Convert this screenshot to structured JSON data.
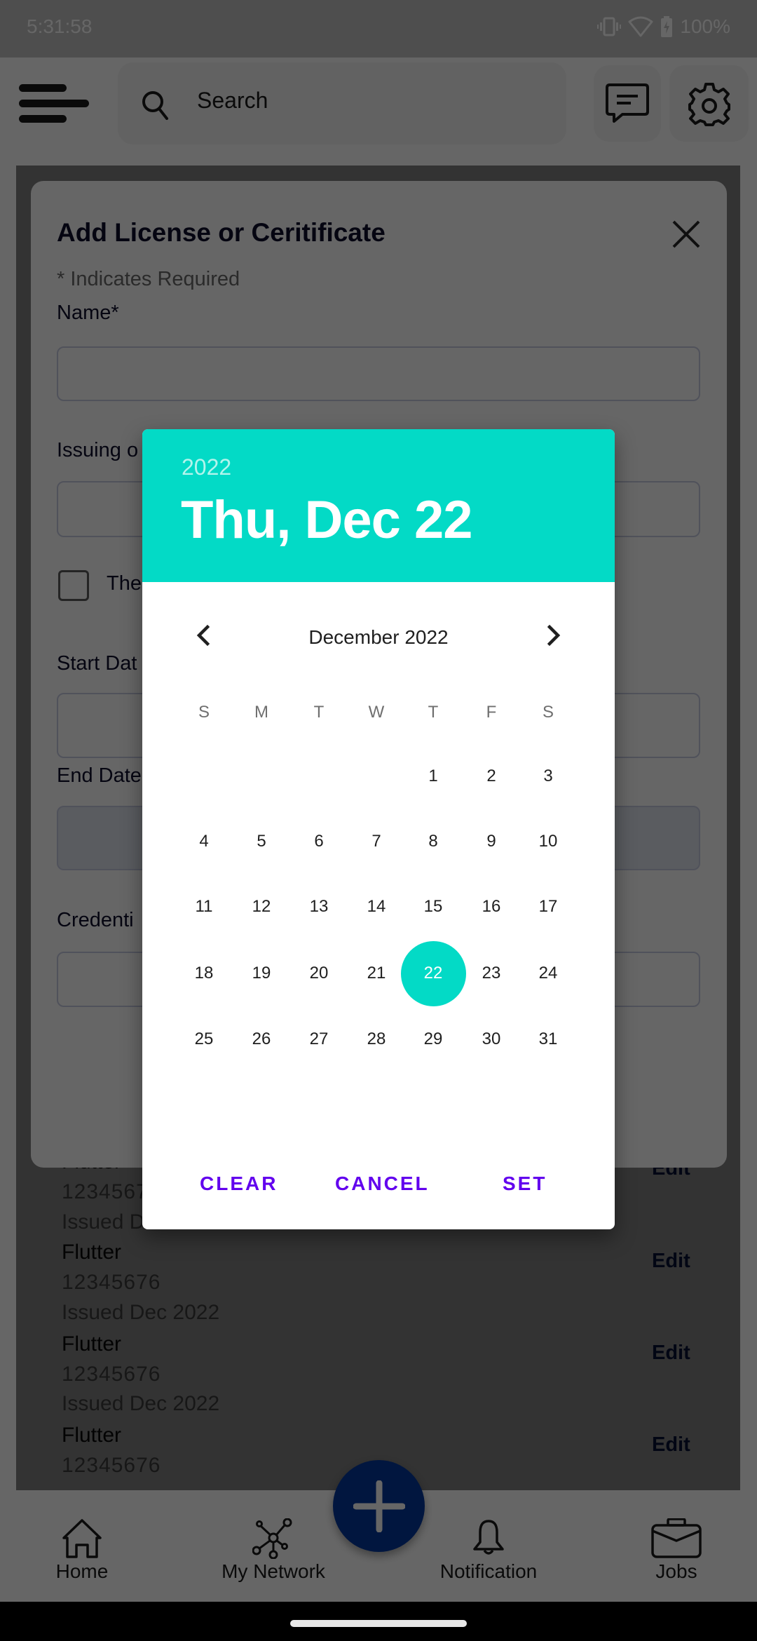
{
  "status_bar": {
    "time": "5:31:58",
    "battery": "100%",
    "icons": [
      "vibrate-icon",
      "wifi-icon",
      "battery-charging-icon"
    ]
  },
  "app_bar": {
    "menu_icon": "hamburger-menu-icon",
    "search_placeholder": "Search",
    "message_icon": "chat-message-icon",
    "settings_icon": "gear-icon"
  },
  "license_modal": {
    "title": "Add License or Ceritificate",
    "required_note": "* Indicates Required",
    "fields": {
      "name_label": "Name*",
      "name_value": "",
      "issuing_label": "Issuing o",
      "issuing_value": "",
      "checkbox_label": "The",
      "checkbox_checked": false,
      "start_date_label": "Start Dat",
      "start_date_value": "",
      "end_date_label": "End Date",
      "end_date_value": "",
      "credential_label": "Credenti",
      "credential_value": ""
    }
  },
  "background_list": {
    "items": [
      {
        "title": "Flutter",
        "number": "1234567",
        "issued": "Issued D",
        "edit": "Edit"
      },
      {
        "title": "Flutter",
        "number": "12345676",
        "issued": "Issued Dec 2022",
        "edit": "Edit"
      },
      {
        "title": "Flutter",
        "number": "12345676",
        "issued": "Issued Dec 2022",
        "edit": "Edit"
      },
      {
        "title": "Flutter",
        "number": "12345676",
        "issued": "",
        "edit": "Edit"
      }
    ]
  },
  "bottom_nav": {
    "items": [
      {
        "label": "Home",
        "icon": "home-icon"
      },
      {
        "label": "My Network",
        "icon": "network-icon"
      },
      {
        "label": "Notification",
        "icon": "bell-icon"
      },
      {
        "label": "Jobs",
        "icon": "briefcase-icon"
      }
    ],
    "fab_icon": "plus-icon"
  },
  "date_picker": {
    "header_year": "2022",
    "header_date": "Thu, Dec 22",
    "month_label": "December 2022",
    "weekdays": [
      "S",
      "M",
      "T",
      "W",
      "T",
      "F",
      "S"
    ],
    "first_weekday_index": 4,
    "days_in_month": 31,
    "selected_day": 22,
    "accent_color": "#03dac6",
    "button_color": "#6200ee",
    "buttons": {
      "clear": "CLEAR",
      "cancel": "CANCEL",
      "set": "SET"
    }
  }
}
